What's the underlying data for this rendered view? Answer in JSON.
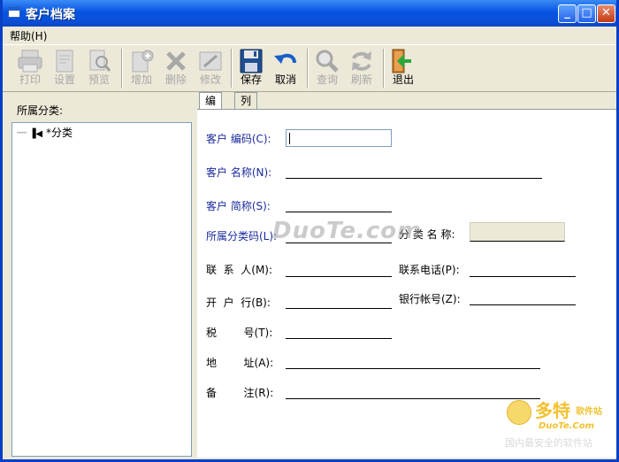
{
  "window": {
    "title": "客户档案"
  },
  "menu": {
    "help": "帮助(H)"
  },
  "toolbar": {
    "print": "打印",
    "settings": "设置",
    "preview": "预览",
    "add": "增加",
    "delete": "删除",
    "edit": "修改",
    "save": "保存",
    "cancel": "取消",
    "query": "查询",
    "refresh": "刷新",
    "exit": "退出"
  },
  "left": {
    "heading": "所属分类:",
    "tree_root": "*分类"
  },
  "tabs": {
    "edit": "编辑",
    "list": "列表"
  },
  "form": {
    "customer_code": "客户 编码(C):",
    "customer_name": "客户 名称(N):",
    "customer_short": "客户 简称(S):",
    "category_code": "所属分类码(L):",
    "category_name": "分 类 名 称:",
    "contact": "联  系  人(M):",
    "phone": "联系电话(P):",
    "bank": "开  户  行(B):",
    "account": "银行帐号(Z):",
    "tax": "税        号(T):",
    "address": "地        址(A):",
    "remark": "备        注(R):"
  },
  "watermark": {
    "text": "DuoTe.com"
  },
  "logo": {
    "big": "多特",
    "small": "软件站",
    "sub": "DuoTe.Com",
    "tag": "国内最安全的软件站"
  }
}
